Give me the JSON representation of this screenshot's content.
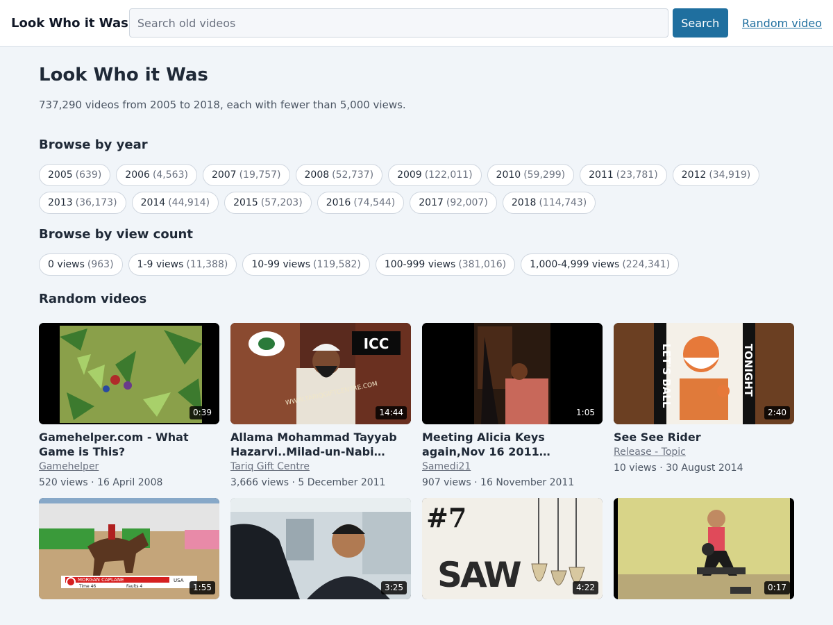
{
  "header": {
    "brand": "Look Who it Was",
    "search_placeholder": "Search old videos",
    "search_button": "Search",
    "random_link": "Random video"
  },
  "intro": {
    "title": "Look Who it Was",
    "subtitle": "737,290 videos from 2005 to 2018, each with fewer than 5,000 views."
  },
  "years": {
    "heading": "Browse by year",
    "items": [
      {
        "label": "2005",
        "count": "(639)"
      },
      {
        "label": "2006",
        "count": "(4,563)"
      },
      {
        "label": "2007",
        "count": "(19,757)"
      },
      {
        "label": "2008",
        "count": "(52,737)"
      },
      {
        "label": "2009",
        "count": "(122,011)"
      },
      {
        "label": "2010",
        "count": "(59,299)"
      },
      {
        "label": "2011",
        "count": "(23,781)"
      },
      {
        "label": "2012",
        "count": "(34,919)"
      },
      {
        "label": "2013",
        "count": "(36,173)"
      },
      {
        "label": "2014",
        "count": "(44,914)"
      },
      {
        "label": "2015",
        "count": "(57,203)"
      },
      {
        "label": "2016",
        "count": "(74,544)"
      },
      {
        "label": "2017",
        "count": "(92,007)"
      },
      {
        "label": "2018",
        "count": "(114,743)"
      }
    ]
  },
  "view_counts": {
    "heading": "Browse by view count",
    "items": [
      {
        "label": "0 views",
        "count": "(963)"
      },
      {
        "label": "1-9 views",
        "count": "(11,388)"
      },
      {
        "label": "10-99 views",
        "count": "(119,582)"
      },
      {
        "label": "100-999 views",
        "count": "(381,016)"
      },
      {
        "label": "1,000-4,999 views",
        "count": "(224,341)"
      }
    ]
  },
  "random": {
    "heading": "Random videos",
    "videos": [
      {
        "title": "Gamehelper.com - What Game is This?",
        "channel": "Gamehelper",
        "meta": "520 views · 16 April 2008",
        "duration": "0:39",
        "thumb": "game"
      },
      {
        "title": "Allama Mohammad Tayyab Hazarvi..Milad-un-Nabi SAW.Part 5",
        "channel": "Tariq Gift Centre",
        "meta": "3,666 views · 5 December 2011",
        "duration": "14:44",
        "thumb": "speaker"
      },
      {
        "title": "Meeting Alicia Keys again,Nov 16 2011 Broadway ,NYC",
        "channel": "Samedi21",
        "meta": "907 views · 16 November 2011",
        "duration": "1:05",
        "thumb": "dark"
      },
      {
        "title": "See See Rider",
        "channel": "Release - Topic",
        "meta": "10 views · 30 August 2014",
        "duration": "2:40",
        "thumb": "poster"
      },
      {
        "title": "",
        "channel": "",
        "meta": "",
        "duration": "1:55",
        "thumb": "horse"
      },
      {
        "title": "",
        "channel": "",
        "meta": "",
        "duration": "3:25",
        "thumb": "interview"
      },
      {
        "title": "",
        "channel": "",
        "meta": "",
        "duration": "4:22",
        "thumb": "saw"
      },
      {
        "title": "",
        "channel": "",
        "meta": "",
        "duration": "0:17",
        "thumb": "gym"
      }
    ]
  },
  "thumb_text": {
    "speaker_logo": "ICC",
    "speaker_url": "WWW.TARIQGIFTCENTRE.COM",
    "poster_left": "LET'S BALL",
    "poster_right": "TONIGHT",
    "horse_name": "MORGAN CAPLANE",
    "horse_country": "USA",
    "horse_time": "Time 46",
    "horse_faults": "Faults 4",
    "saw_number": "#7",
    "saw_word": "SAW"
  }
}
